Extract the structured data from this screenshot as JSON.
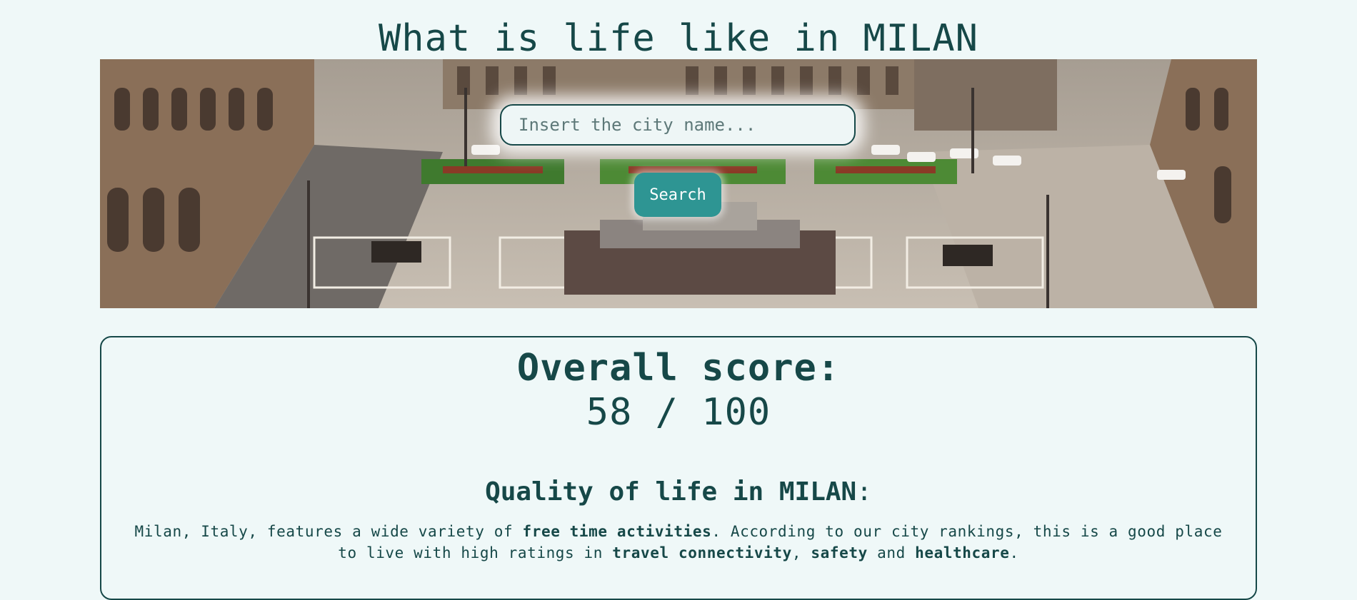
{
  "page": {
    "title": "What is life like in MILAN"
  },
  "search": {
    "placeholder": "Insert the city name...",
    "value": "",
    "button_label": "Search"
  },
  "hero": {
    "image_alt": "Piazza del Duomo, Milan"
  },
  "score": {
    "label": "Overall score:",
    "value": "58 / 100"
  },
  "quality": {
    "heading": "Quality of life in MILAN",
    "heading_suffix": ":",
    "summary": {
      "part1": "Milan, Italy, features a wide variety of ",
      "bold1": "free time activities",
      "part2": ". According to our city rankings, this is a good place to live with high ratings in ",
      "bold2": "travel connectivity",
      "part3": ", ",
      "bold3": "safety",
      "part4": " and ",
      "bold4": "healthcare",
      "part5": "."
    }
  },
  "colors": {
    "text": "#164848",
    "background": "#eff8f8",
    "button": "#2e9593"
  }
}
